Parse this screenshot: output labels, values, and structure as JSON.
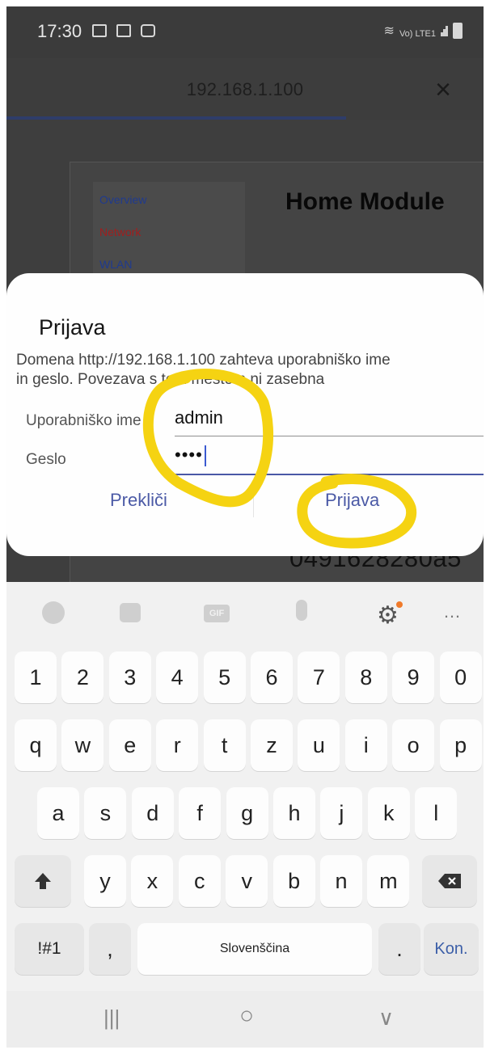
{
  "status_bar": {
    "time": "17:30",
    "network_label": "Vo) LTE1"
  },
  "browser": {
    "url_title": "192.168.1.100",
    "close_symbol": "×"
  },
  "webpage": {
    "nav_links": [
      {
        "label": "Overview",
        "color": "#1f3a8f"
      },
      {
        "label": "Network",
        "color": "#a01e1e"
      },
      {
        "label": "WLAN",
        "color": "#1f3a8f"
      }
    ],
    "title": "Home Module",
    "hash_text": "0491628280a5"
  },
  "dialog": {
    "title": "Prijava",
    "message_line1": "Domena http://192.168.1.100 zahteva uporabniško ime",
    "message_line2": "in geslo. Povezava s tem mestom ni zasebna",
    "username_label": "Uporabniško ime",
    "username_value": "admin",
    "password_label": "Geslo",
    "password_value": "••••",
    "cancel_label": "Prekliči",
    "login_label": "Prijava"
  },
  "keyboard": {
    "toolbar": [
      "emoji-icon",
      "sticker-icon",
      "GIF",
      "mic-icon",
      "gear-icon",
      "more-icon"
    ],
    "row_numbers": [
      "1",
      "2",
      "3",
      "4",
      "5",
      "6",
      "7",
      "8",
      "9",
      "0"
    ],
    "row_q": [
      "q",
      "w",
      "e",
      "r",
      "t",
      "z",
      "u",
      "i",
      "o",
      "p"
    ],
    "row_a": [
      "a",
      "s",
      "d",
      "f",
      "g",
      "h",
      "j",
      "k",
      "l"
    ],
    "row_y": [
      "y",
      "x",
      "c",
      "v",
      "b",
      "n",
      "m"
    ],
    "symbols_label": "!#1",
    "comma_label": ",",
    "space_label": "Slovenščina",
    "period_label": ".",
    "enter_label": "Kon."
  },
  "nav_bar": {
    "recent": "|||",
    "home": "○",
    "back": "∨"
  },
  "colors": {
    "annotation": "#f5d312",
    "accent": "#4b5aa6"
  }
}
